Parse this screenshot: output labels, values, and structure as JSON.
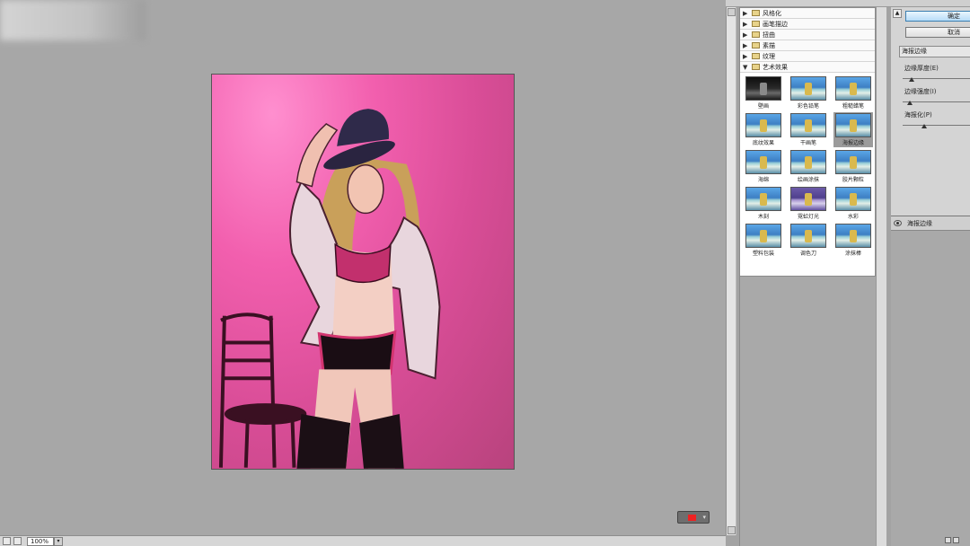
{
  "zoom": {
    "value": "100%",
    "dropdown_glyph": "▾"
  },
  "gallery": {
    "folders_top": [
      {
        "label": "风格化",
        "expanded": false
      },
      {
        "label": "画笔描边",
        "expanded": false
      },
      {
        "label": "扭曲",
        "expanded": false
      },
      {
        "label": "素描",
        "expanded": false
      },
      {
        "label": "纹理",
        "expanded": false
      }
    ],
    "artistic_folder": {
      "label": "艺术效果",
      "expanded": true
    },
    "filters": [
      {
        "label": "壁画",
        "style": "dark"
      },
      {
        "label": "彩色铅笔",
        "style": "normal"
      },
      {
        "label": "粗糙蜡笔",
        "style": "normal"
      },
      {
        "label": "底纹效果",
        "style": "normal"
      },
      {
        "label": "干画笔",
        "style": "normal"
      },
      {
        "label": "海报边缘",
        "style": "normal",
        "selected": true
      },
      {
        "label": "海绵",
        "style": "normal"
      },
      {
        "label": "绘画涂抹",
        "style": "normal"
      },
      {
        "label": "胶片颗粒",
        "style": "normal"
      },
      {
        "label": "木刻",
        "style": "normal"
      },
      {
        "label": "霓虹灯光",
        "style": "purple"
      },
      {
        "label": "水彩",
        "style": "normal"
      },
      {
        "label": "塑料包装",
        "style": "normal"
      },
      {
        "label": "调色刀",
        "style": "normal"
      },
      {
        "label": "涂抹棒",
        "style": "normal"
      }
    ]
  },
  "settings": {
    "ok_label": "确定",
    "cancel_label": "取消",
    "selected_filter": "海报边缘",
    "params": [
      {
        "label": "边缘厚度(E)",
        "level": 0.12
      },
      {
        "label": "边缘强度(I)",
        "level": 0.1
      },
      {
        "label": "海报化(P)",
        "level": 0.3
      }
    ]
  },
  "layer": {
    "label": "海报边缘"
  },
  "colors": {
    "accent": "#b7dcf7",
    "canvas_bg": "#a7a7a7",
    "photo_pink": "#e0559c"
  }
}
